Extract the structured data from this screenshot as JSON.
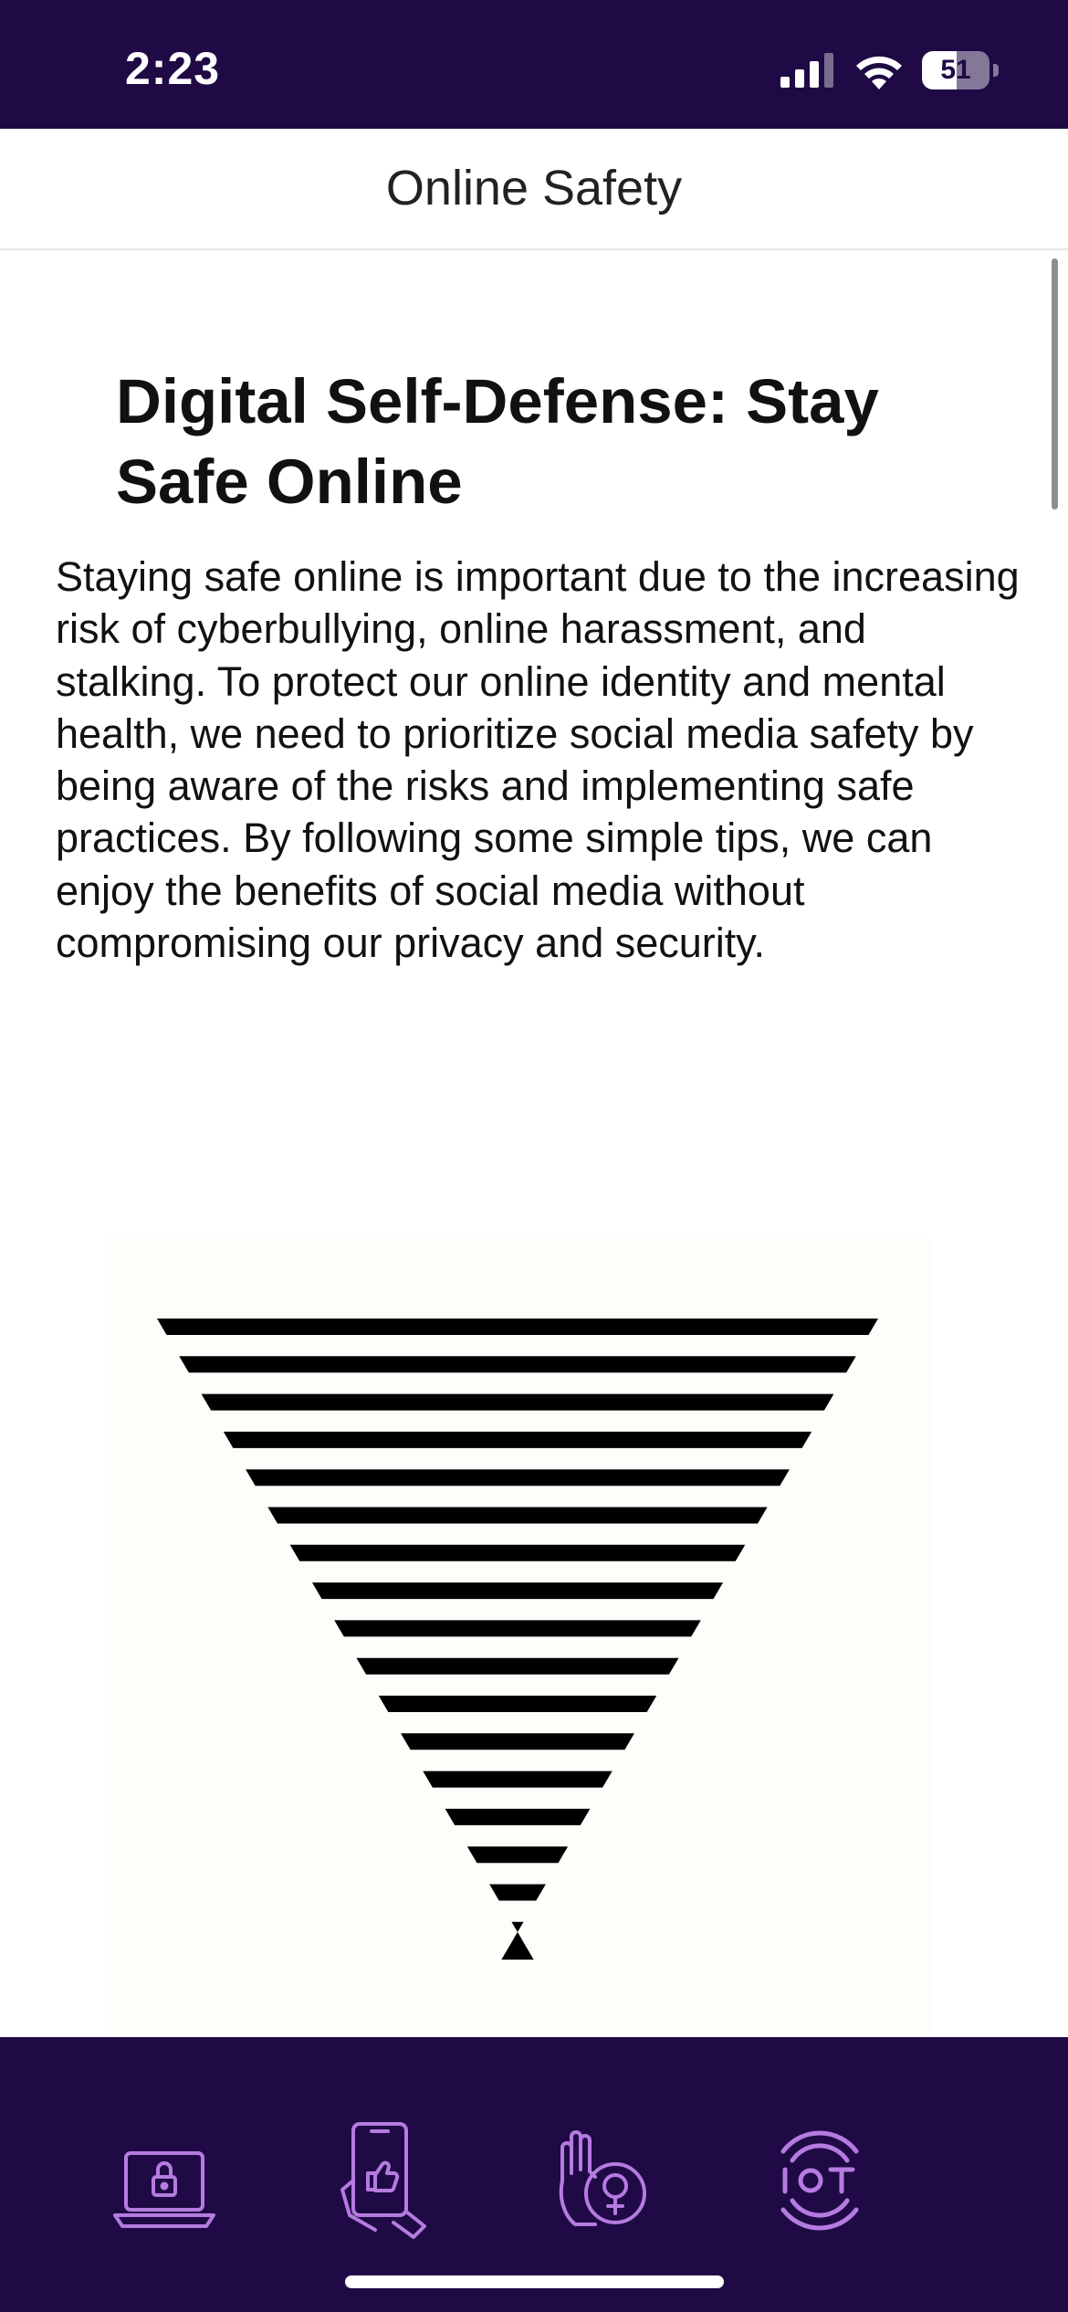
{
  "status_bar": {
    "time": "2:23",
    "battery_percent": "51",
    "battery_level": 0.51,
    "signal_bars": 3
  },
  "header": {
    "title": "Online Safety"
  },
  "article": {
    "headline": "Digital Self-Defense: Stay Safe Online",
    "body": "Staying safe online is important due to the increasing risk of cyberbullying, online harassment, and stalking. To protect our online identity and mental health, we need to prioritize social media safety by being aware of the risks and implementing safe practices. By following some simple tips, we can enjoy the benefits of social media without compromising our privacy and security."
  },
  "tabs": [
    {
      "icon": "laptop-lock-icon"
    },
    {
      "icon": "phone-like-icon"
    },
    {
      "icon": "hand-female-symbol-icon"
    },
    {
      "icon": "iot-signal-icon"
    }
  ],
  "colors": {
    "bar_background": "#1f0a45",
    "tab_icon": "#b57be0",
    "text": "#111111"
  }
}
